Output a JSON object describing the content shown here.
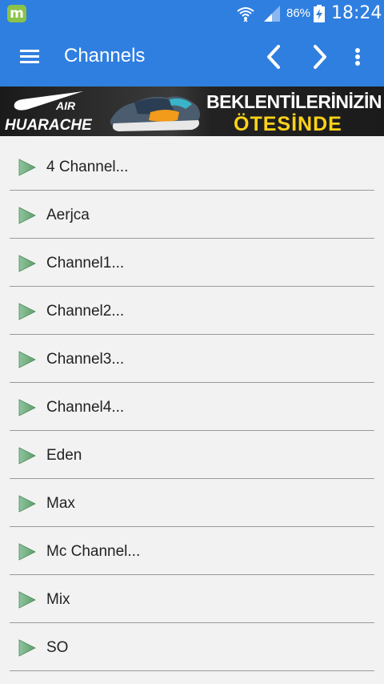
{
  "status_bar": {
    "app_icon": "m",
    "battery_percent": "86%",
    "time": "18:24",
    "icons": [
      "wifi-icon",
      "signal-icon",
      "battery-charging-icon"
    ]
  },
  "toolbar": {
    "title": "Channels",
    "icons": [
      "menu-icon",
      "chevron-left-icon",
      "chevron-right-icon",
      "more-vert-icon"
    ],
    "color": "#2f7fe0"
  },
  "ad": {
    "brand_air": "AIR",
    "brand_model": "HUARACHE",
    "headline_line1": "BEKLENTİLERİNİZİN",
    "headline_line2": "ÖTESİNDE",
    "headline_line2_color": "#ffd21a"
  },
  "channels": [
    {
      "label": "4 Channel..."
    },
    {
      "label": "Aerjca"
    },
    {
      "label": "Channel1..."
    },
    {
      "label": "Channel2..."
    },
    {
      "label": "Channel3..."
    },
    {
      "label": "Channel4..."
    },
    {
      "label": "Eden"
    },
    {
      "label": "Max"
    },
    {
      "label": "Mc Channel..."
    },
    {
      "label": "Mix"
    },
    {
      "label": "SO"
    }
  ],
  "play_icon_color": "#5f9e6e"
}
